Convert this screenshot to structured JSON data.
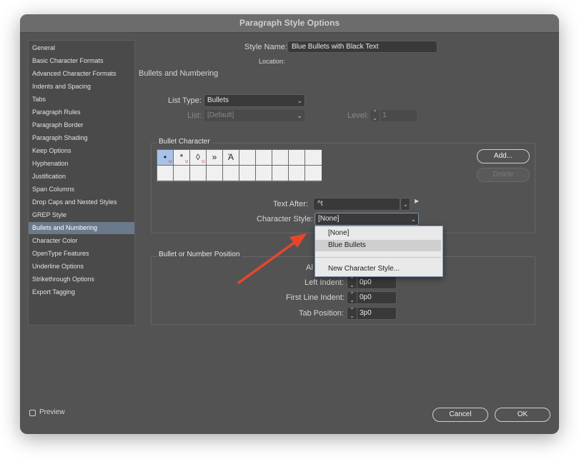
{
  "window": {
    "title": "Paragraph Style Options"
  },
  "sidebar": {
    "items": [
      {
        "label": "General"
      },
      {
        "label": "Basic Character Formats"
      },
      {
        "label": "Advanced Character Formats"
      },
      {
        "label": "Indents and Spacing"
      },
      {
        "label": "Tabs"
      },
      {
        "label": "Paragraph Rules"
      },
      {
        "label": "Paragraph Border"
      },
      {
        "label": "Paragraph Shading"
      },
      {
        "label": "Keep Options"
      },
      {
        "label": "Hyphenation"
      },
      {
        "label": "Justification"
      },
      {
        "label": "Span Columns"
      },
      {
        "label": "Drop Caps and Nested Styles"
      },
      {
        "label": "GREP Style"
      },
      {
        "label": "Bullets and Numbering",
        "selected": true
      },
      {
        "label": "Character Color"
      },
      {
        "label": "OpenType Features"
      },
      {
        "label": "Underline Options"
      },
      {
        "label": "Strikethrough Options"
      },
      {
        "label": "Export Tagging"
      }
    ]
  },
  "header": {
    "style_name_label": "Style Name:",
    "style_name_value": "Blue Bullets with Black Text",
    "location_label": "Location:"
  },
  "section": {
    "title": "Bullets and Numbering"
  },
  "list": {
    "type_label": "List Type:",
    "type_value": "Bullets",
    "list_label": "List:",
    "list_value": "[Default]",
    "level_label": "Level:",
    "level_value": "1"
  },
  "bullet_character": {
    "title": "Bullet Character",
    "glyphs": [
      {
        "glyph": "•",
        "mark": "u",
        "selected": true
      },
      {
        "glyph": "*",
        "mark": "u"
      },
      {
        "glyph": "◊",
        "mark": "u"
      },
      {
        "glyph": "»",
        "mark": ""
      },
      {
        "glyph": "Ά",
        "mark": ""
      }
    ],
    "add_label": "Add...",
    "delete_label": "Delete",
    "text_after_label": "Text After:",
    "text_after_value": "^t",
    "char_style_label": "Character Style:",
    "char_style_value": "[None]"
  },
  "dropdown": {
    "options": [
      {
        "label": "[None]"
      },
      {
        "label": "Blue Bullets",
        "highlighted": true
      },
      {
        "label": "New Character Style..."
      }
    ]
  },
  "position": {
    "title": "Bullet or Number Position",
    "alignment_label_partial": "Al",
    "left_indent_label": "Left Indent:",
    "left_indent_value": "0p0",
    "first_line_label": "First Line Indent:",
    "first_line_value": "0p0",
    "tab_position_label": "Tab Position:",
    "tab_position_value": "3p0"
  },
  "footer": {
    "preview_label": "Preview",
    "cancel_label": "Cancel",
    "ok_label": "OK"
  },
  "colors": {
    "dialog_bg": "#535353",
    "selection": "#6a7a8c",
    "annotation_arrow": "#e8462c"
  }
}
